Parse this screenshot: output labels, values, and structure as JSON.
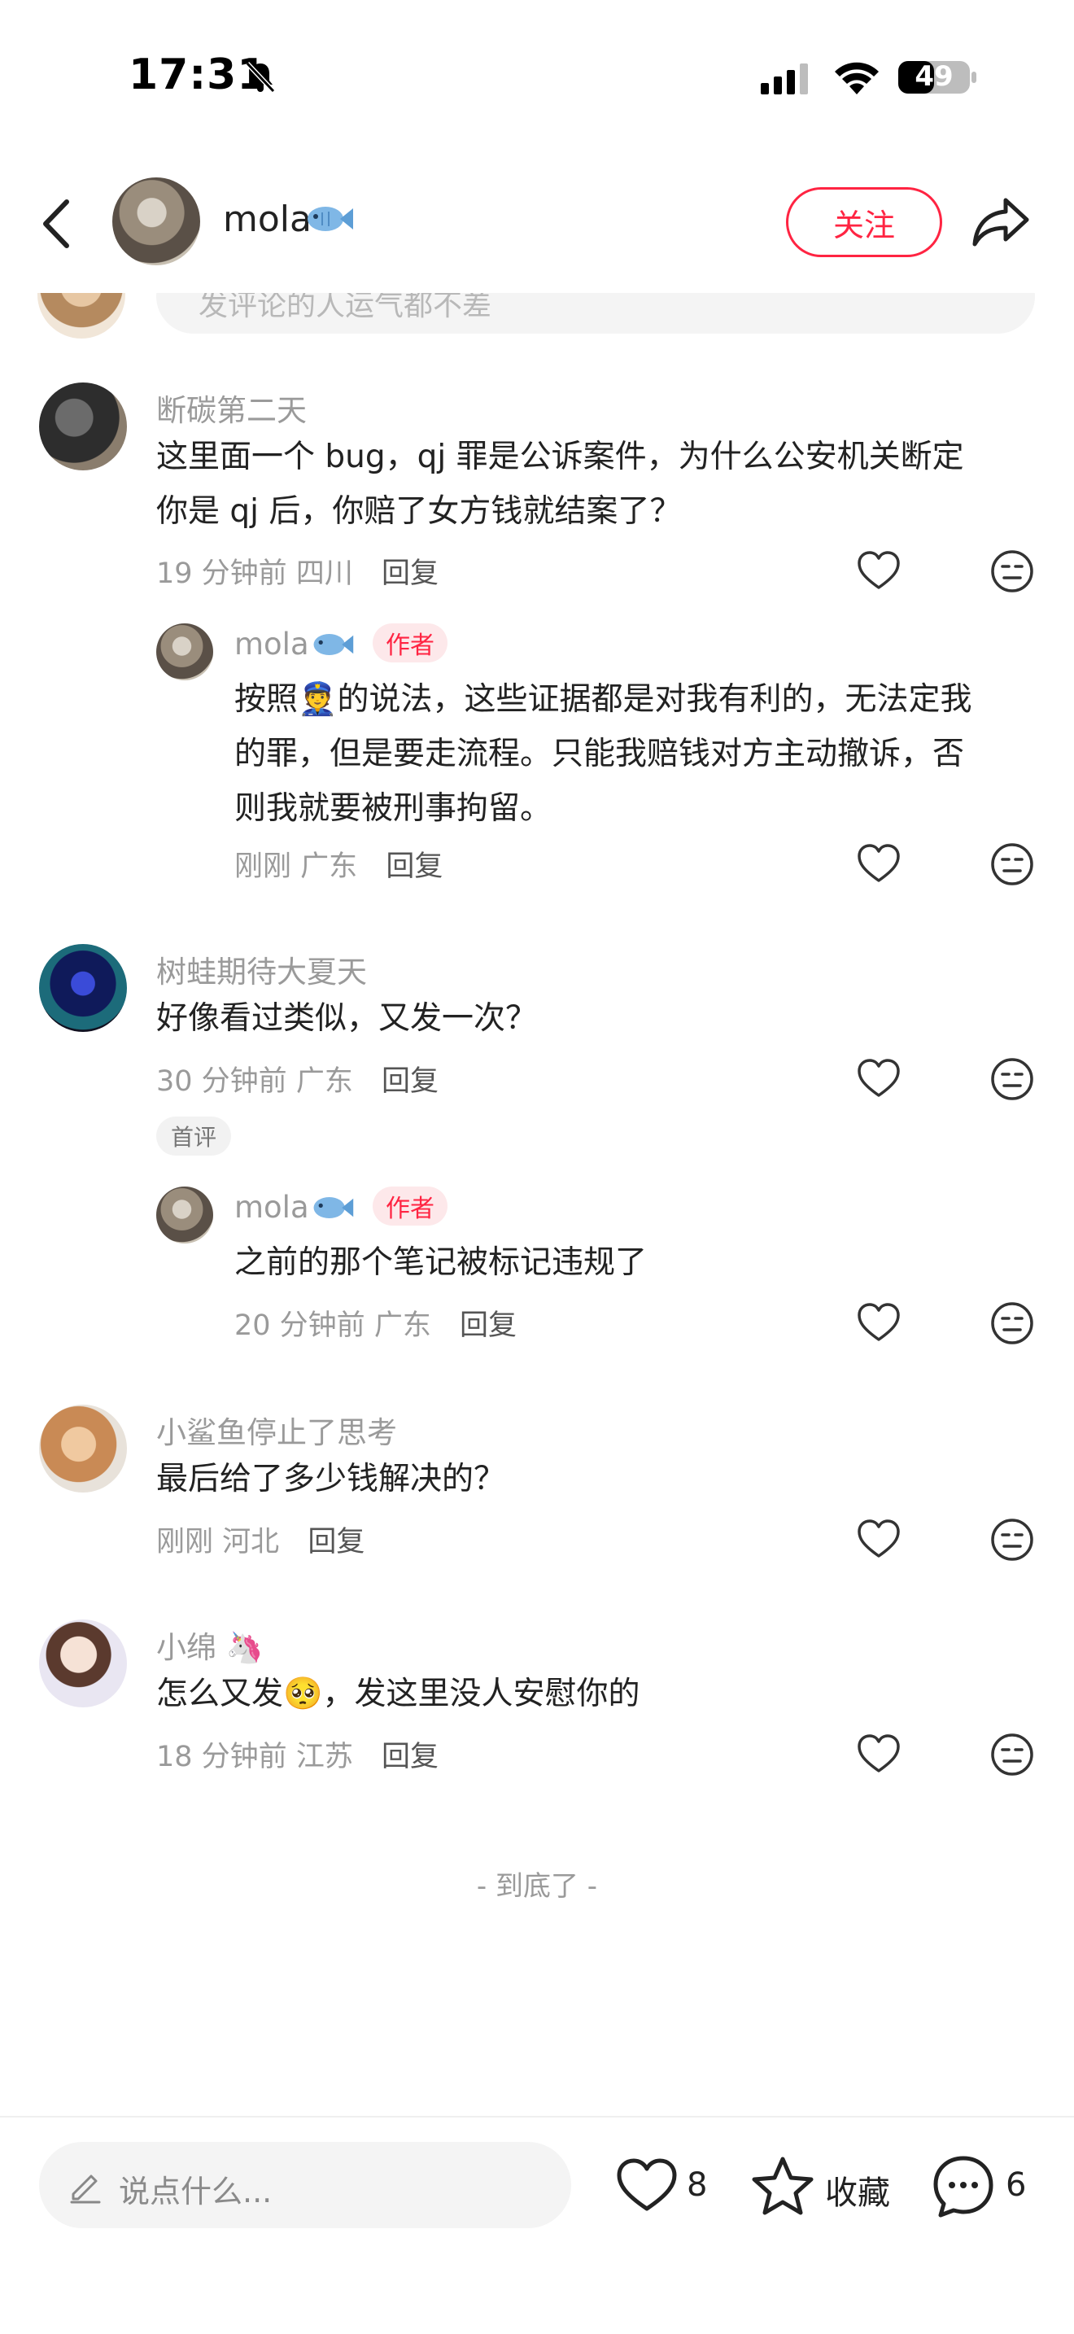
{
  "status_bar": {
    "time": "17:31",
    "battery": "49"
  },
  "header": {
    "username": "mola",
    "follow_label": "关注"
  },
  "top_partial": {
    "placeholder": "发评论的人运气都不差"
  },
  "comments": [
    {
      "username": "断碳第二天",
      "text_lines": [
        "这里面一个 bug，qj 罪是公诉案件，为什么公安机关断定",
        "你是 qj 后，你赔了女方钱就结案了？"
      ],
      "time": "19 分钟前",
      "location": "四川",
      "reply_label": "回复",
      "reply": {
        "username": "mola",
        "badge": "作者",
        "text_lines": [
          "按照👮的说法，这些证据都是对我有利的，无法定我",
          "的罪，但是要走流程。只能我赔钱对方主动撤诉，否",
          "则我就要被刑事拘留。"
        ],
        "time": "刚刚",
        "location": "广东",
        "reply_label": "回复"
      }
    },
    {
      "username": "树蛙期待大夏天",
      "text_lines": [
        "好像看过类似，又发一次？"
      ],
      "time": "30 分钟前",
      "location": "广东",
      "reply_label": "回复",
      "badge": "首评",
      "reply": {
        "username": "mola",
        "badge": "作者",
        "text_lines": [
          "之前的那个笔记被标记违规了"
        ],
        "time": "20 分钟前",
        "location": "广东",
        "reply_label": "回复"
      }
    },
    {
      "username": "小鲨鱼停止了思考",
      "text_lines": [
        "最后给了多少钱解决的？"
      ],
      "time": "刚刚",
      "location": "河北",
      "reply_label": "回复"
    },
    {
      "username": "小绵 🦄",
      "text_lines": [
        "怎么又发🥺，发这里没人安慰你的"
      ],
      "time": "18 分钟前",
      "location": "江苏",
      "reply_label": "回复"
    }
  ],
  "end_text": "- 到底了 -",
  "bottom_bar": {
    "input_placeholder": "说点什么...",
    "like_count": "8",
    "collect_label": "收藏",
    "comment_count": "6"
  },
  "colors": {
    "accent": "#ff2442",
    "muted_text": "#9a9a9a",
    "author_badge_bg": "#fde8ea"
  },
  "icons": [
    "bell-slash-icon",
    "signal-icon",
    "wifi-icon",
    "battery-icon",
    "back-icon",
    "fish-icon",
    "share-icon",
    "heart-icon",
    "neutral-face-icon",
    "pencil-icon",
    "star-icon",
    "chat-bubble-icon"
  ]
}
